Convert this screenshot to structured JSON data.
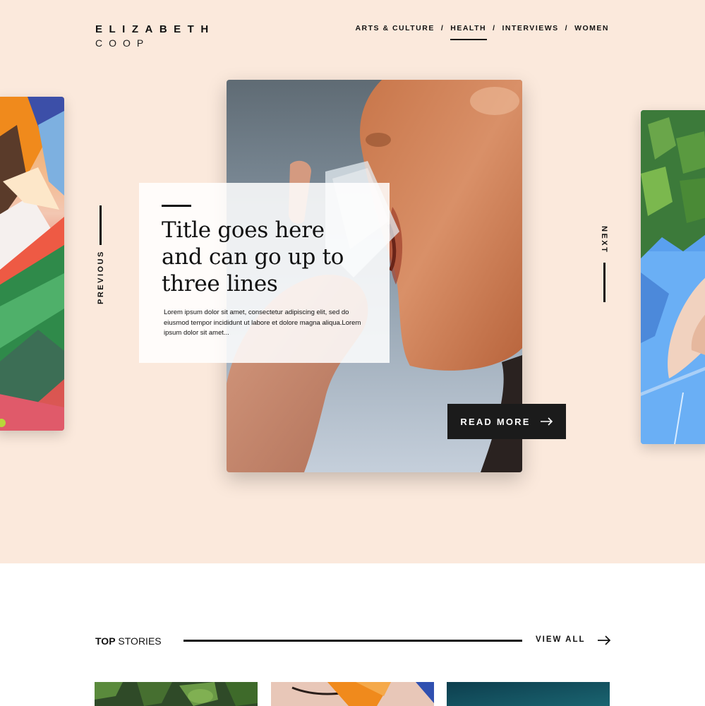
{
  "brand": {
    "line1": "ELIZABETH",
    "line2": "COOP"
  },
  "nav": {
    "items": [
      {
        "label": "ARTS & CULTURE",
        "active": false
      },
      {
        "label": "HEALTH",
        "active": true
      },
      {
        "label": "INTERVIEWS",
        "active": false
      },
      {
        "label": "WOMEN",
        "active": false
      }
    ],
    "separator": "/"
  },
  "slider": {
    "previous_label": "PREVIOUS",
    "next_label": "NEXT"
  },
  "featured": {
    "title_line1": "Title goes here",
    "title_line2": "and can go up to",
    "title_line3": "three lines",
    "body": "Lorem ipsum dolor sit amet, consectetur adipiscing elit, sed do eiusmod tempor incididunt ut labore et dolore magna aliqua.Lorem ipsum dolor sit amet...",
    "cta_label": "READ MORE"
  },
  "top_stories": {
    "label_bold": "TOP",
    "label_rest": " STORIES",
    "view_all_label": "VIEW ALL"
  },
  "colors": {
    "hero_background": "#fbe9dc",
    "accent_dark": "#1b1b1b",
    "page_background": "#ffffff"
  },
  "icons": {
    "cta_arrow": "arrow-right-icon",
    "view_all_arrow": "arrow-right-icon"
  }
}
